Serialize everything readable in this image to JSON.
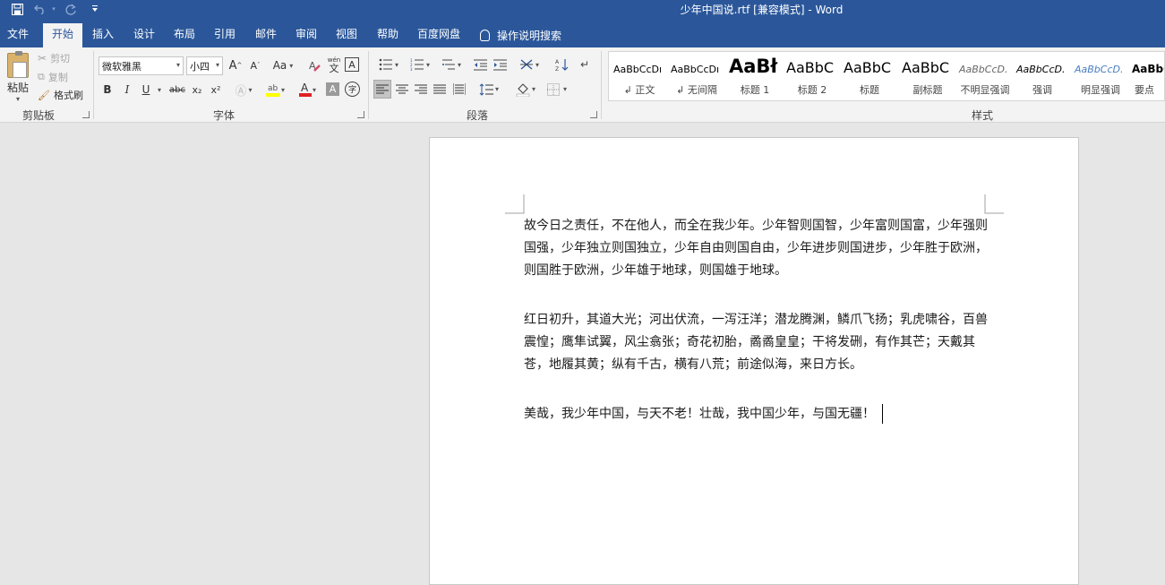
{
  "titlebar": {
    "title": "少年中国说.rtf [兼容模式]  -  Word",
    "save_icon": "save-icon",
    "undo_icon": "undo-icon",
    "redo_icon": "redo-icon",
    "customize_icon": "customize-qat-icon"
  },
  "tabs": [
    {
      "label": "文件"
    },
    {
      "label": "开始"
    },
    {
      "label": "插入"
    },
    {
      "label": "设计"
    },
    {
      "label": "布局"
    },
    {
      "label": "引用"
    },
    {
      "label": "邮件"
    },
    {
      "label": "审阅"
    },
    {
      "label": "视图"
    },
    {
      "label": "帮助"
    },
    {
      "label": "百度网盘"
    }
  ],
  "tell_me": {
    "label": "操作说明搜索",
    "icon": "lightbulb-icon"
  },
  "clipboard": {
    "paste": "粘贴",
    "cut": "剪切",
    "copy": "复制",
    "format_painter": "格式刷",
    "group_label": "剪贴板"
  },
  "font": {
    "font_name": "微软雅黑",
    "font_size": "小四",
    "group_label": "字体",
    "grow": "A",
    "shrink": "A",
    "change_case": "Aa",
    "phonetic": "wén",
    "bold": "B",
    "italic": "I",
    "underline": "U",
    "strike": "abc",
    "subscript": "x₂",
    "superscript": "x²",
    "font_color": "A",
    "highlight_color": "#ffff00",
    "font_color_value": "#e02020"
  },
  "paragraph": {
    "group_label": "段落"
  },
  "styles": {
    "group_label": "样式",
    "items": [
      {
        "preview": "AaBbCcDı",
        "name": "↲ 正文"
      },
      {
        "preview": "AaBbCcDı",
        "name": "↲ 无间隔"
      },
      {
        "preview": "AaBł",
        "name": "标题 1"
      },
      {
        "preview": "AaBbC",
        "name": "标题 2"
      },
      {
        "preview": "AaBbC",
        "name": "标题"
      },
      {
        "preview": "AaBbC",
        "name": "副标题"
      },
      {
        "preview": "AaBbCcD.",
        "name": "不明显强调"
      },
      {
        "preview": "AaBbCcD.",
        "name": "强调"
      },
      {
        "preview": "AaBbCcD.",
        "name": "明显强调"
      },
      {
        "preview": "AaBbC",
        "name": "要点"
      }
    ]
  },
  "document": {
    "paragraphs": [
      "故今日之责任，不在他人，而全在我少年。少年智则国智，少年富则国富，少年强则国强，少年独立则国独立，少年自由则国自由，少年进步则国进步，少年胜于欧洲，则国胜于欧洲，少年雄于地球，则国雄于地球。",
      "红日初升，其道大光；河出伏流，一泻汪洋；潜龙腾渊，鳞爪飞扬；乳虎啸谷，百兽震惶；鹰隼试翼，风尘翕张；奇花初胎，矞矞皇皇；干将发硎，有作其芒；天戴其苍，地履其黄；纵有千古，横有八荒；前途似海，来日方长。",
      "美哉，我少年中国，与天不老！壮哉，我中国少年，与国无疆！"
    ]
  },
  "colors": {
    "accent": "#2b579a",
    "ribbon_bg": "#f3f3f3",
    "canvas_bg": "#e6e6e6"
  }
}
